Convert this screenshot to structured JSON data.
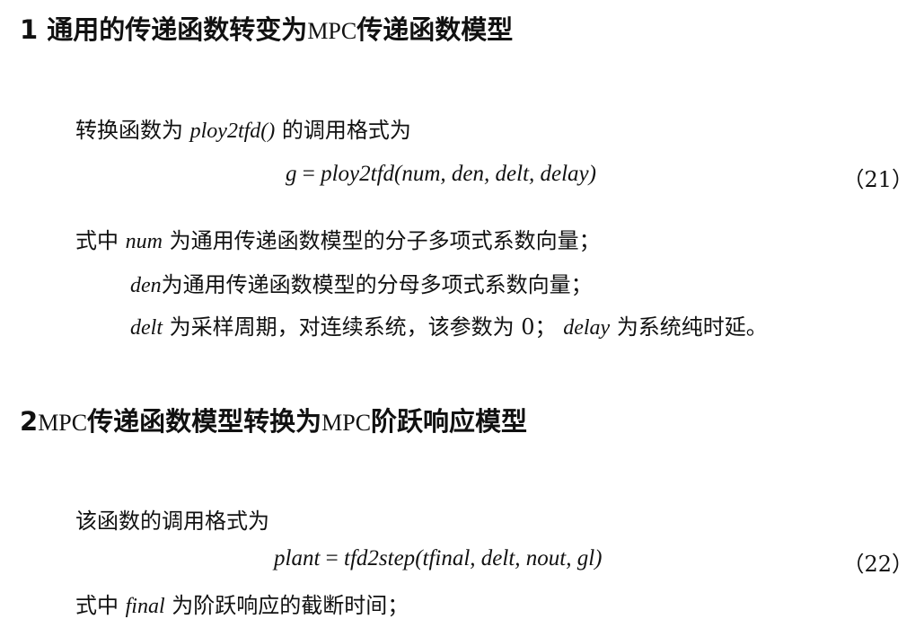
{
  "section1": {
    "num": "1",
    "title_a": "通用的传递函数转变为",
    "title_mpc": "MPC",
    "title_b": "传递函数模型",
    "intro_a": "转换函数为",
    "intro_fn": "ploy2tfd()",
    "intro_b": "的调用格式为",
    "eq_lhs": "g",
    "eq_eq": "=",
    "eq_fn": "ploy2tfd",
    "eq_args": "(num, den, delt, delay)",
    "eq_num": "（21）",
    "where1_a": "式中",
    "where1_var": "num",
    "where1_b": "为通用传递函数模型的分子多项式系数向量；",
    "where2_var": "den",
    "where2_b": "为通用传递函数模型的分母多项式系数向量；",
    "where3_var": "delt",
    "where3_b": "为采样周期，对连续系统，该参数为 0；",
    "where3_var2": "delay",
    "where3_c": "为系统纯时延。"
  },
  "section2": {
    "num": "2",
    "title_mpc1": "MPC",
    "title_a": "传递函数模型转换为",
    "title_mpc2": "MPC",
    "title_b": "阶跃响应模型",
    "intro": "该函数的调用格式为",
    "eq_lhs": "plant",
    "eq_eq": "=",
    "eq_fn": "tfd2step",
    "eq_args": "(tfinal, delt, nout, gl)",
    "eq_num": "（22）",
    "where1_a": "式中",
    "where1_var": "final",
    "where1_b": "为阶跃响应的截断时间；"
  }
}
